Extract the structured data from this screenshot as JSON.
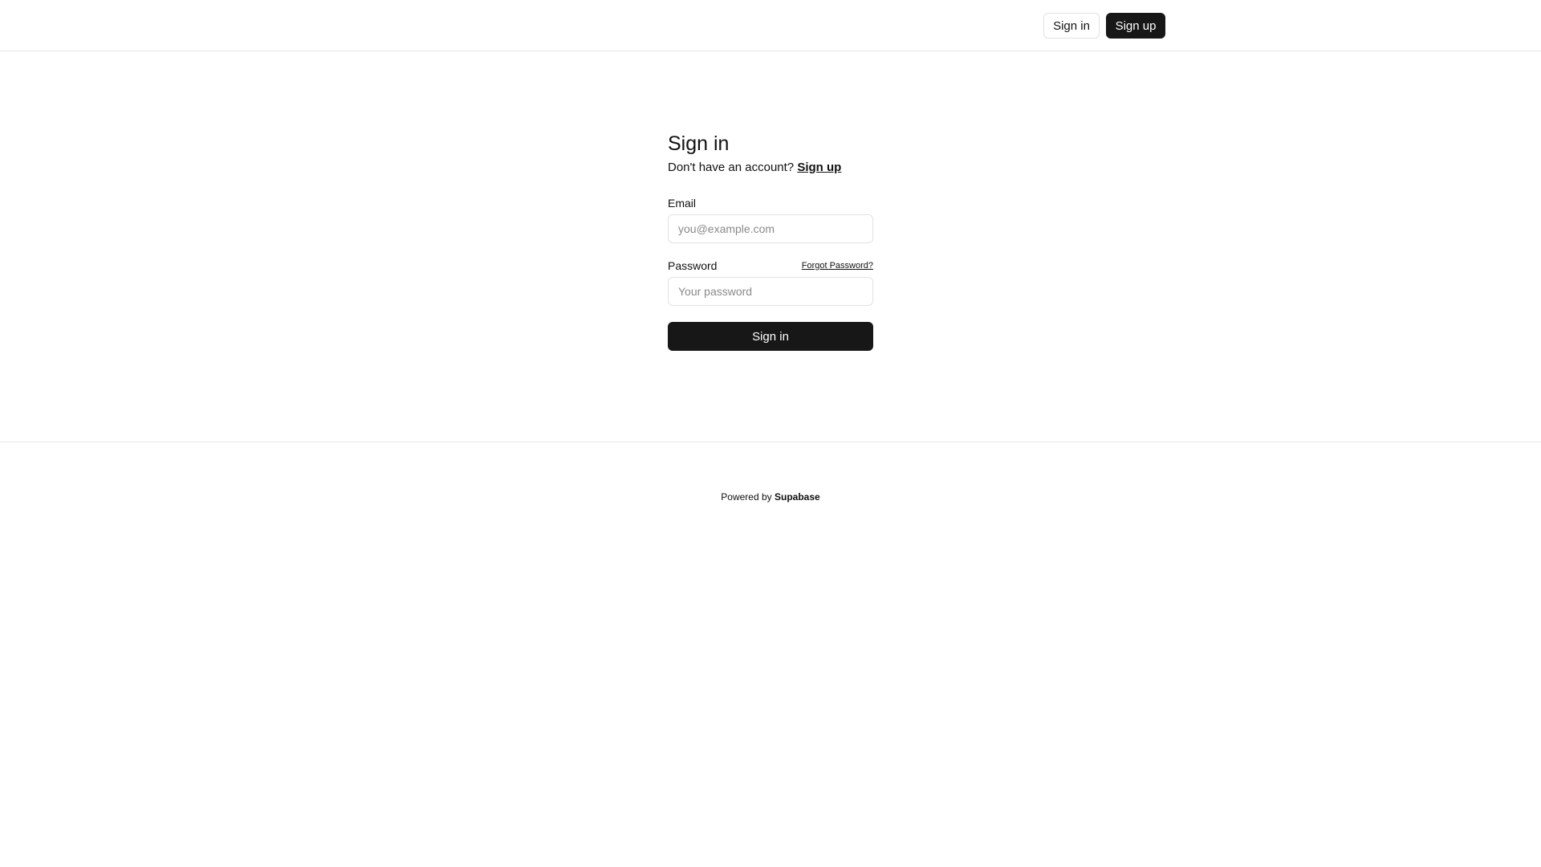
{
  "header": {
    "sign_in_label": "Sign in",
    "sign_up_label": "Sign up"
  },
  "form": {
    "title": "Sign in",
    "subtitle_text": "Don't have an account?",
    "subtitle_link": "Sign up",
    "email_label": "Email",
    "email_placeholder": "you@example.com",
    "email_value": "",
    "password_label": "Password",
    "forgot_label": "Forgot Password?",
    "password_placeholder": "Your password",
    "password_value": "",
    "submit_label": "Sign in"
  },
  "footer": {
    "prefix": "Powered by",
    "brand": "Supabase"
  }
}
